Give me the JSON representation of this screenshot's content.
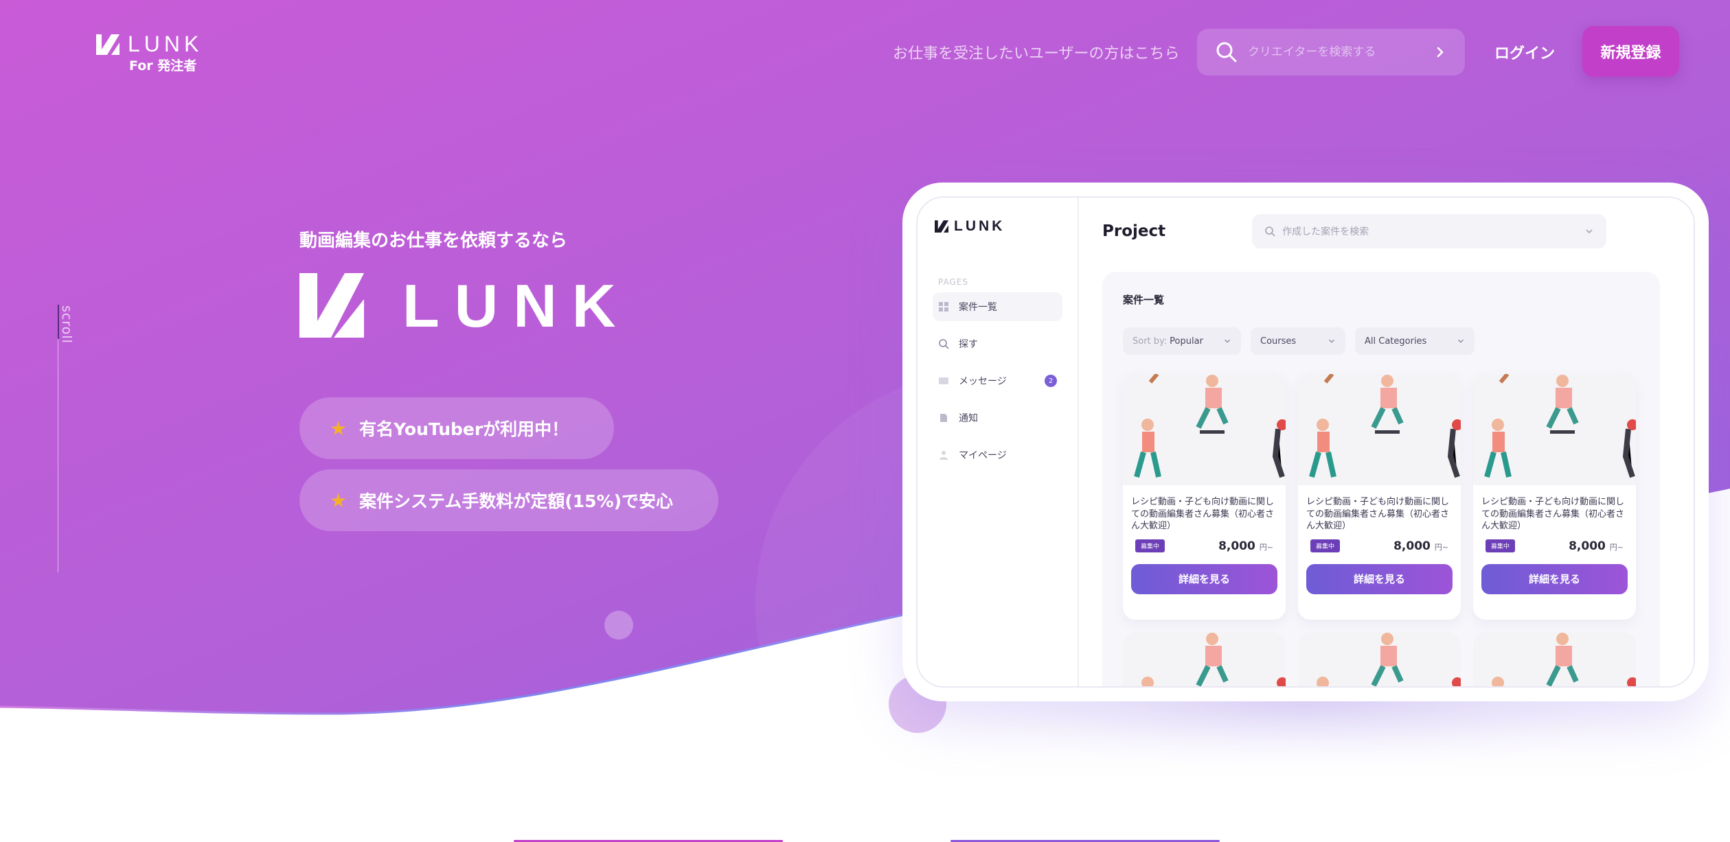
{
  "header": {
    "logo_word": "LUNK",
    "logo_sub": "For 発注者",
    "creator_link": "お仕事を受注したいユーザーの方はこちら",
    "search_placeholder": "クリエイターを検索する",
    "login_label": "ログイン",
    "signup_label": "新規登録"
  },
  "scroll_label": "scroll",
  "hero": {
    "tagline": "動画編集のお仕事を依頼するなら",
    "logo_word": "LUNK",
    "features": [
      "有名YouTuberが利用中！",
      "案件システム手数料が定額(15%)で安心"
    ]
  },
  "mockup": {
    "logo_word": "LUNK",
    "pages_label": "PAGES",
    "nav": [
      {
        "label": "案件一覧",
        "icon": "grid-icon"
      },
      {
        "label": "探す",
        "icon": "search-icon"
      },
      {
        "label": "メッセージ",
        "icon": "message-icon",
        "badge": "2"
      },
      {
        "label": "通知",
        "icon": "bell-icon"
      },
      {
        "label": "マイページ",
        "icon": "user-icon"
      }
    ],
    "title": "Project",
    "search_placeholder": "作成した案件を検索",
    "panel_title": "案件一覧",
    "filters": {
      "sort_prefix": "Sort by:",
      "sort_value": "Popular",
      "courses": "Courses",
      "categories": "All Categories"
    },
    "cards": [
      {
        "text": "レシピ動画・子ども向け動画に関しての動画編集者さん募集（初心者さん大歓迎）",
        "tag": "募集中",
        "price": "8,000",
        "unit": "円~",
        "button": "詳細を見る"
      },
      {
        "text": "レシピ動画・子ども向け動画に関しての動画編集者さん募集（初心者さん大歓迎）",
        "tag": "募集中",
        "price": "8,000",
        "unit": "円~",
        "button": "詳細を見る"
      },
      {
        "text": "レシピ動画・子ども向け動画に関しての動画編集者さん募集（初心者さん大歓迎）",
        "tag": "募集中",
        "price": "8,000",
        "unit": "円~",
        "button": "詳細を見る"
      }
    ]
  },
  "colors": {
    "hero_gradient_start": "#c75bd6",
    "hero_gradient_end": "#9b62dc",
    "accent": "#c23fc9",
    "button_gradient_start": "#6e5cd6",
    "button_gradient_end": "#9d54d8"
  }
}
